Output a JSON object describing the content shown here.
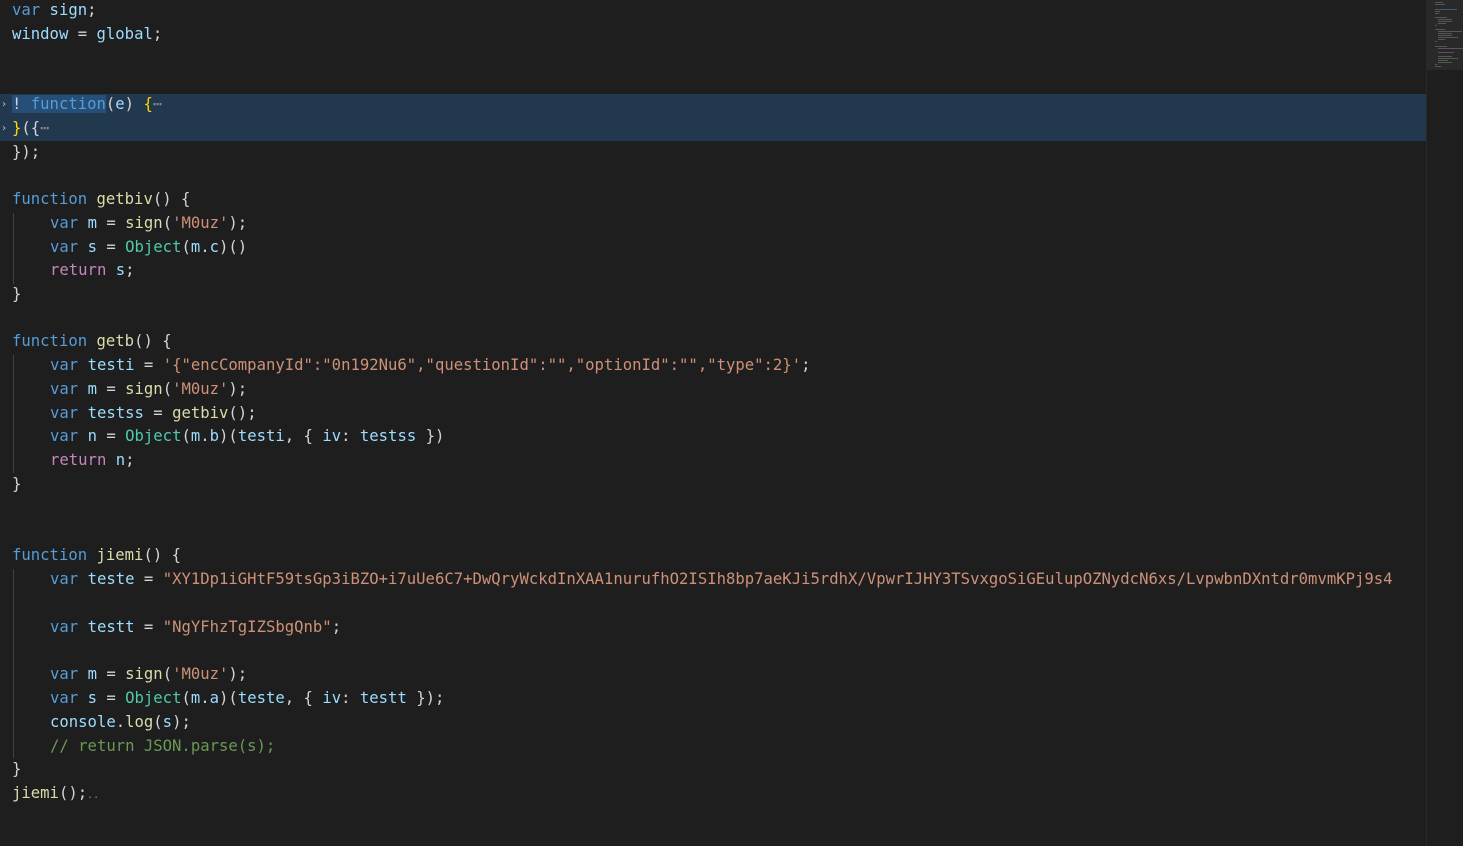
{
  "editor": {
    "lines": {
      "l1": {
        "t1": "var",
        "t2": " sign",
        "t3": ";"
      },
      "l2": {
        "t1": "window",
        "t2": " = ",
        "t3": "global",
        "t4": ";"
      },
      "l3": {
        "t1": "!",
        "t2": " ",
        "t3": "function",
        "t4": "(",
        "t5": "e",
        "t6": ") ",
        "t7": "{",
        "t8": "⋯"
      },
      "l4": {
        "t1": "}",
        "t2": "({",
        "t3": "⋯"
      },
      "l5": {
        "t1": "});"
      },
      "l6": {
        "t1": "function",
        "t2": " ",
        "t3": "getbiv",
        "t4": "() {"
      },
      "l7": {
        "t1": "var",
        "t2": " ",
        "t3": "m",
        "t4": " = ",
        "t5": "sign",
        "t6": "(",
        "t7": "'M0uz'",
        "t8": ");"
      },
      "l8": {
        "t1": "var",
        "t2": " ",
        "t3": "s",
        "t4": " = ",
        "t5": "Object",
        "t6": "(",
        "t7": "m",
        "t8": ".",
        "t9": "c",
        "t10": ")()"
      },
      "l9": {
        "t1": "return",
        "t2": " ",
        "t3": "s",
        "t4": ";"
      },
      "l10": {
        "t1": "}"
      },
      "l11": {
        "t1": "function",
        "t2": " ",
        "t3": "getb",
        "t4": "() {"
      },
      "l12": {
        "t1": "var",
        "t2": " ",
        "t3": "testi",
        "t4": " = ",
        "t5": "'{\"encCompanyId\":\"0n192Nu6\",\"questionId\":\"\",\"optionId\":\"\",\"type\":2}'",
        "t6": ";"
      },
      "l13": {
        "t1": "var",
        "t2": " ",
        "t3": "m",
        "t4": " = ",
        "t5": "sign",
        "t6": "(",
        "t7": "'M0uz'",
        "t8": ");"
      },
      "l14": {
        "t1": "var",
        "t2": " ",
        "t3": "testss",
        "t4": " = ",
        "t5": "getbiv",
        "t6": "();"
      },
      "l15": {
        "t1": "var",
        "t2": " ",
        "t3": "n",
        "t4": " = ",
        "t5": "Object",
        "t6": "(",
        "t7": "m",
        "t8": ".",
        "t9": "b",
        "t10": ")(",
        "t11": "testi",
        "t12": ", { ",
        "t13": "iv",
        "t14": ": ",
        "t15": "testss",
        "t16": " })"
      },
      "l16": {
        "t1": "return",
        "t2": " ",
        "t3": "n",
        "t4": ";"
      },
      "l17": {
        "t1": "}"
      },
      "l18": {
        "t1": "function",
        "t2": " ",
        "t3": "jiemi",
        "t4": "() {"
      },
      "l19": {
        "t1": "var",
        "t2": " ",
        "t3": "teste",
        "t4": " = ",
        "t5": "\"XY1Dp1iGHtF59tsGp3iBZO+i7uUe6C7+DwQryWckdInXAA1nurufhO2ISIh8bp7aeKJi5rdhX/VpwrIJHY3TSvxgoSiGEulupOZNydcN6xs/LvpwbnDXntdr0mvmKPj9s4"
      },
      "l20": {
        "t1": "var",
        "t2": " ",
        "t3": "testt",
        "t4": " = ",
        "t5": "\"NgYFhzTgIZSbgQnb\"",
        "t6": ";"
      },
      "l21": {
        "t1": "var",
        "t2": " ",
        "t3": "m",
        "t4": " = ",
        "t5": "sign",
        "t6": "(",
        "t7": "'M0uz'",
        "t8": ");"
      },
      "l22": {
        "t1": "var",
        "t2": " ",
        "t3": "s",
        "t4": " = ",
        "t5": "Object",
        "t6": "(",
        "t7": "m",
        "t8": ".",
        "t9": "a",
        "t10": ")(",
        "t11": "teste",
        "t12": ", { ",
        "t13": "iv",
        "t14": ": ",
        "t15": "testt",
        "t16": " });"
      },
      "l23": {
        "t1": "console",
        "t2": ".",
        "t3": "log",
        "t4": "(",
        "t5": "s",
        "t6": ");"
      },
      "l24": {
        "t1": "// return JSON.parse(s);"
      },
      "l25": {
        "t1": "}"
      },
      "l26": {
        "t1": "jiemi",
        "t2": "();",
        "t3": ".."
      }
    },
    "colors": {
      "background": "#1e1e1e",
      "keyword": "#569cd6",
      "control": "#c586c0",
      "function": "#dcdcaa",
      "variable": "#9cdcfe",
      "string": "#ce9178",
      "type": "#4ec9b0",
      "comment": "#6a9955",
      "selection": "#264f78"
    }
  }
}
